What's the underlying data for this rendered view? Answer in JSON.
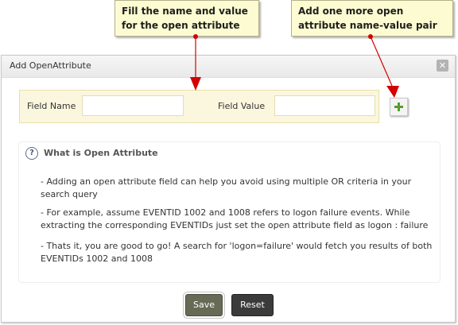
{
  "callouts": {
    "fill": {
      "line1": "Fill the name and value",
      "line2": "for the open attribute"
    },
    "add": {
      "line1": "Add one more open",
      "line2": "attribute name-value pair"
    }
  },
  "dialog": {
    "title": "Add OpenAttribute",
    "close_glyph": "✕",
    "field_name_label": "Field Name",
    "field_name_value": "",
    "field_value_label": "Field Value",
    "field_value_value": ""
  },
  "info": {
    "icon_glyph": "?",
    "title": "What is Open Attribute",
    "lines": [
      "- Adding an open attribute field can help you avoid using multiple OR criteria in your search query",
      "- For example, assume EVENTID 1002 and 1008 refers to logon failure events. While extracting the corresponding EVENTIDs just set the open attribute field as logon : failure",
      "- Thats it, you are good to go! A search for 'logon=failure' would fetch you results of both EVENTIDs 1002 and 1008"
    ]
  },
  "buttons": {
    "save": "Save",
    "reset": "Reset"
  },
  "colors": {
    "callout_bg": "#fcfbd1",
    "fields_bg": "#fbf7de",
    "arrow": "#d40000",
    "plus": "#5a9d2a"
  }
}
